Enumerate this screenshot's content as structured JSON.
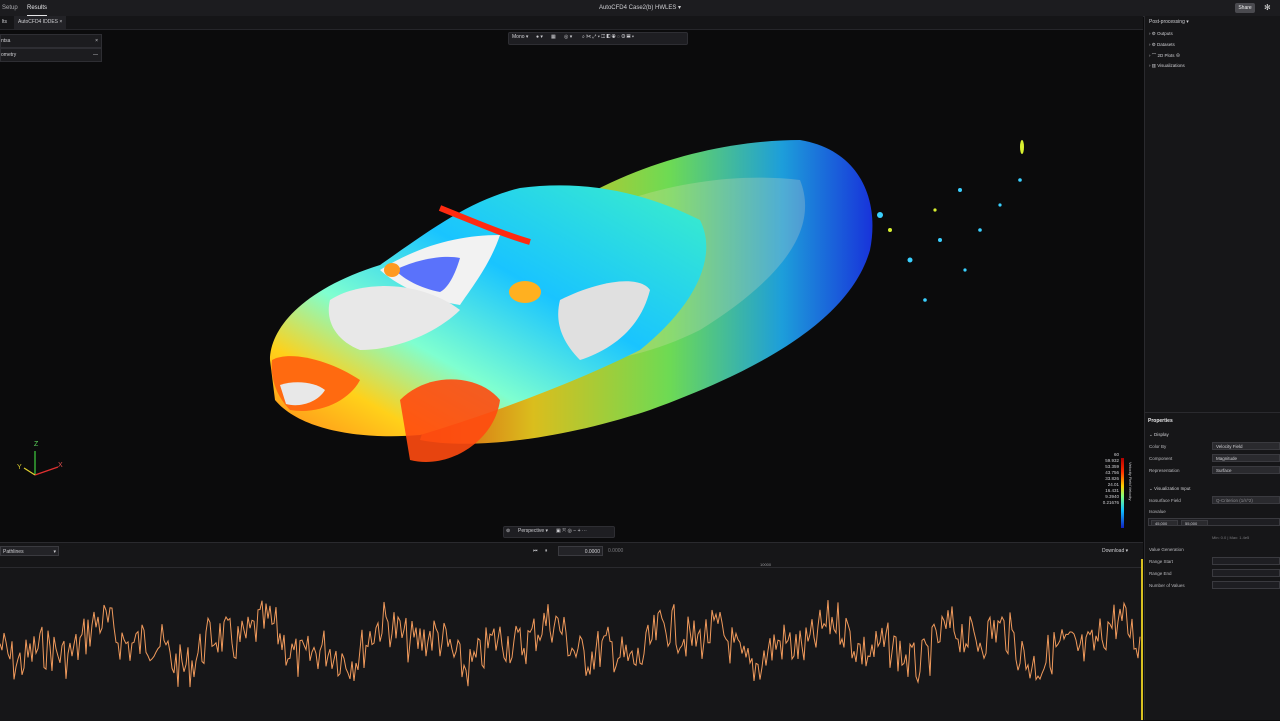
{
  "topbar": {
    "tabs": [
      {
        "label": "Setup"
      },
      {
        "label": "Results"
      }
    ],
    "title": "AutoCFD4 Case2(b) HWLES",
    "share_label": "Share"
  },
  "file_tabs": [
    {
      "label": "lts"
    },
    {
      "label": "AutoCFD4 IDDES"
    }
  ],
  "left_panel": {
    "row1": "ntsa",
    "row2": "ometry"
  },
  "viewport_toolbar": {
    "mode": "Mono"
  },
  "bottom_toolbar": {
    "projection": "Perspective"
  },
  "axes": {
    "z": "Z",
    "y": "Y",
    "x": "X"
  },
  "legend": {
    "title": "Velocity Field Velocity",
    "values": [
      "60",
      "59.932",
      "53.359",
      "43.756",
      "33.826",
      "24.01",
      "16.431",
      "9.3940",
      "0.21676"
    ]
  },
  "right_panel": {
    "header": "Post-processing",
    "tree": [
      {
        "label": "Outputs"
      },
      {
        "label": "Datasets"
      },
      {
        "label": "2D Plots"
      },
      {
        "label": "Visualizations"
      }
    ],
    "properties": {
      "title": "Properties",
      "display_header": "Display",
      "color_by_label": "Color By",
      "color_by_value": "Velocity Field",
      "component_label": "Component",
      "component_value": "Magnitude",
      "representation_label": "Representation",
      "representation_value": "Surface",
      "vis_header": "Visualization Input",
      "isosurface_label": "Isosurface Field",
      "isosurface_value": "Q-Criterion (1/s^2)",
      "isovalue_label": "Isovalue",
      "isovalue_chip1": "45,000",
      "isovalue_chip2": "55,000",
      "minmax": "Min: 0.0 | Max: 1.4e5",
      "value_generation_label": "Value Generation",
      "range_start_label": "Range Start",
      "range_end_label": "Range End",
      "num_values_label": "Number of Values"
    }
  },
  "timeline": {
    "select_label": "Pathlines",
    "frame_value": "0.0000",
    "frame_total": "0.0000",
    "download_label": "Download",
    "marker_label": "10000"
  },
  "colors": {
    "accent": "#f0a060",
    "background": "#0b0b0c",
    "panel": "#161618"
  }
}
